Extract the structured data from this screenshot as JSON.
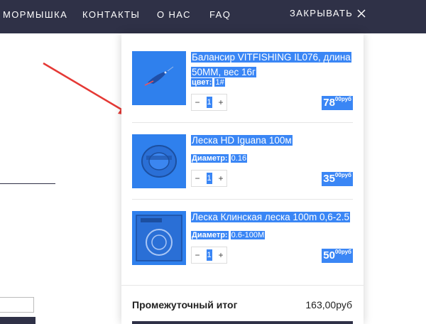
{
  "nav": {
    "items": [
      "МОРМЫШКА",
      "КОНТАКТЫ",
      "О НАС",
      "FAQ"
    ],
    "close_label": "ЗАКРЫВАТЬ"
  },
  "cart": {
    "items": [
      {
        "title": "Балансир VITFISHING IL076, длина 50MM, вес 16г",
        "attr_label": "цвет:",
        "attr_value": "1#",
        "qty": "1",
        "price_main": "78",
        "price_sup": "00руб",
        "thumb_icon": "jig-lure-image"
      },
      {
        "title": "Леска HD Iguana 100м",
        "attr_label": "Диаметр:",
        "attr_value": "0.16",
        "qty": "1",
        "price_main": "35",
        "price_sup": "00руб",
        "thumb_icon": "fishing-line-spool-image"
      },
      {
        "title": "Леска Клинская леска 100m 0,6-2.5",
        "attr_label": "Диаметр:",
        "attr_value": "0.6-100M",
        "qty": "1",
        "price_main": "50",
        "price_sup": "00руб",
        "thumb_icon": "fishing-line-package-image"
      }
    ],
    "subtotal_label": "Промежуточный итог",
    "subtotal_value": "163,00руб"
  },
  "colors": {
    "nav_bg": "#2f3147",
    "selection": "#3a86f5",
    "arrow": "#e53935"
  }
}
